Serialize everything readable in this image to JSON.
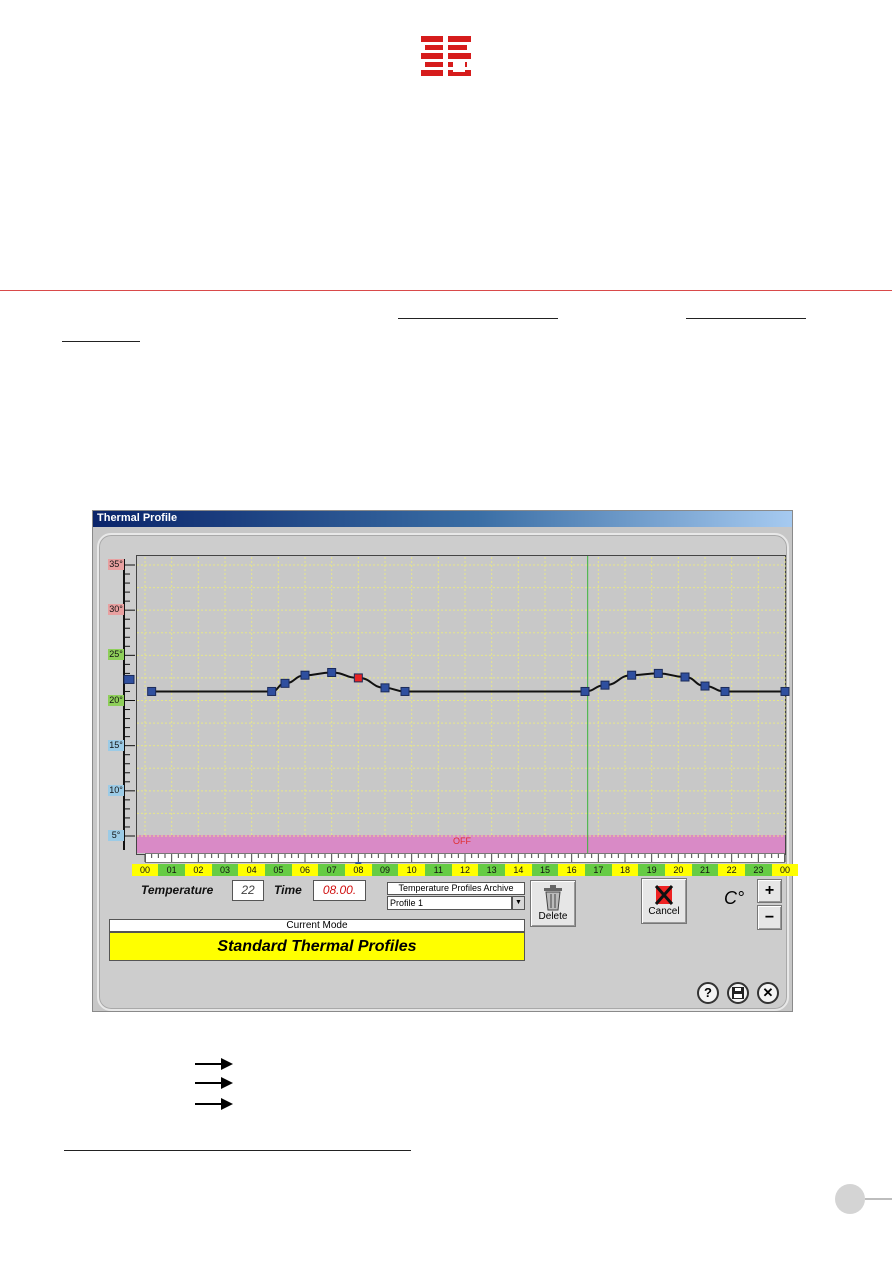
{
  "window": {
    "title": "Thermal Profile"
  },
  "chart_data": {
    "type": "line",
    "y_ticks": [
      "35°",
      "30°",
      "25°",
      "20°",
      "15°",
      "10°",
      "5°"
    ],
    "y_tick_colors": [
      "#e8a0a0",
      "#e8a0a0",
      "#8ecf5a",
      "#8ecf5a",
      "#9ccbe6",
      "#9ccbe6",
      "#9ccbe6"
    ],
    "ylim": [
      5,
      35
    ],
    "xlim": [
      0,
      24
    ],
    "hours": [
      "00",
      "01",
      "02",
      "03",
      "04",
      "05",
      "06",
      "07",
      "08",
      "09",
      "10",
      "11",
      "12",
      "13",
      "14",
      "15",
      "16",
      "17",
      "18",
      "19",
      "20",
      "21",
      "22",
      "23",
      "00"
    ],
    "hour_colors": [
      "#ffff00",
      "#66cc44"
    ],
    "off_label": "OFF",
    "current_time_hour": 16.6,
    "selected_point_index": 5,
    "series": [
      {
        "values": [
          [
            0.25,
            21
          ],
          [
            4.75,
            21
          ],
          [
            5.25,
            21.9
          ],
          [
            6,
            22.8
          ],
          [
            7,
            23.1
          ],
          [
            8,
            22.5
          ],
          [
            9,
            21.4
          ],
          [
            9.75,
            21
          ],
          [
            16.5,
            21
          ],
          [
            17.25,
            21.7
          ],
          [
            18.25,
            22.8
          ],
          [
            19.25,
            23
          ],
          [
            20.25,
            22.6
          ],
          [
            21,
            21.6
          ],
          [
            21.75,
            21
          ],
          [
            24,
            21
          ]
        ],
        "color": "#111111"
      }
    ],
    "grid": true
  },
  "controls": {
    "temperature_label": "Temperature",
    "temperature_value": "22",
    "time_label": "Time",
    "time_value": "08.00.",
    "archive_title": "Temperature Profiles Archive",
    "archive_selected": "Profile 1",
    "delete_label": "Delete",
    "cancel_label": "Cancel",
    "unit": "C°",
    "plus": "+",
    "minus": "−",
    "current_mode_title": "Current Mode",
    "current_mode_value": "Standard Thermal Profiles",
    "help": "?",
    "close": "✕"
  }
}
